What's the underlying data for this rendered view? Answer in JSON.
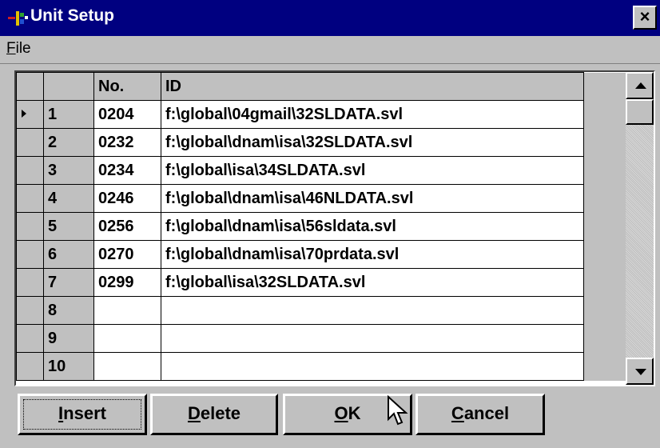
{
  "window": {
    "title": "Unit Setup",
    "close_label": "×",
    "accent": "#000080",
    "face": "#c0c0c0"
  },
  "menu": [
    {
      "mnemonic": "F",
      "rest": "ile"
    }
  ],
  "grid": {
    "columns": [
      "No.",
      "ID"
    ],
    "current_row": 1,
    "rows": [
      {
        "num": "1",
        "no": "0204",
        "id": "f:\\global\\04gmail\\32SLDATA.svl"
      },
      {
        "num": "2",
        "no": "0232",
        "id": "f:\\global\\dnam\\isa\\32SLDATA.svl"
      },
      {
        "num": "3",
        "no": "0234",
        "id": "f:\\global\\isa\\34SLDATA.svl"
      },
      {
        "num": "4",
        "no": "0246",
        "id": "f:\\global\\dnam\\isa\\46NLDATA.svl"
      },
      {
        "num": "5",
        "no": "0256",
        "id": "f:\\global\\dnam\\isa\\56sldata.svl"
      },
      {
        "num": "6",
        "no": "0270",
        "id": "f:\\global\\dnam\\isa\\70prdata.svl"
      },
      {
        "num": "7",
        "no": "0299",
        "id": "f:\\global\\isa\\32SLDATA.svl"
      },
      {
        "num": "8",
        "no": "",
        "id": ""
      },
      {
        "num": "9",
        "no": "",
        "id": ""
      },
      {
        "num": "10",
        "no": "",
        "id": ""
      }
    ]
  },
  "buttons": {
    "insert": {
      "mnemonic": "I",
      "rest": "nsert"
    },
    "delete": {
      "mnemonic": "D",
      "rest": "elete"
    },
    "ok": {
      "mnemonic": "O",
      "rest": "K"
    },
    "cancel": {
      "mnemonic": "C",
      "rest": "ancel"
    }
  }
}
